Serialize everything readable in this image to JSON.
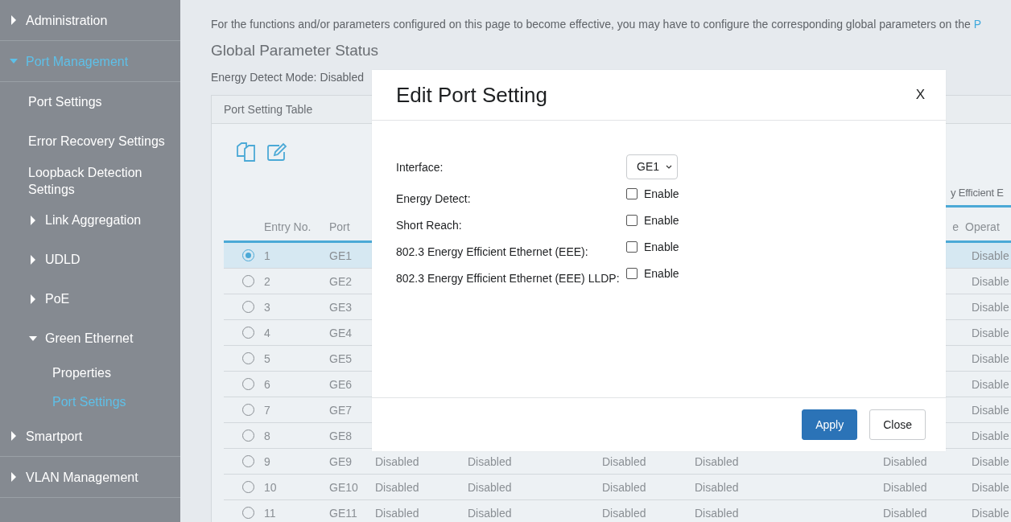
{
  "sidebar": {
    "items": [
      {
        "label": "Administration",
        "expanded": false,
        "selected": false
      },
      {
        "label": "Port Management",
        "expanded": true,
        "selected": true,
        "children": [
          {
            "label": "Port Settings",
            "selected": false
          },
          {
            "label": "Error Recovery Settings",
            "selected": false
          },
          {
            "label": "Loopback Detection Settings",
            "selected": false
          },
          {
            "label": "Link Aggregation",
            "expanded": false,
            "selected": false
          },
          {
            "label": "UDLD",
            "expanded": false,
            "selected": false
          },
          {
            "label": "PoE",
            "expanded": false,
            "selected": false
          },
          {
            "label": "Green Ethernet",
            "expanded": true,
            "selected": false,
            "children": [
              {
                "label": "Properties",
                "selected": false
              },
              {
                "label": "Port Settings",
                "selected": true
              }
            ]
          }
        ]
      },
      {
        "label": "Smartport",
        "expanded": false,
        "selected": false
      },
      {
        "label": "VLAN Management",
        "expanded": false,
        "selected": false
      }
    ]
  },
  "notice": {
    "text": "For the functions and/or parameters configured on this page to become effective, you may have to configure the corresponding global parameters on the",
    "link": "P"
  },
  "heading": "Global Parameter Status",
  "status": {
    "label": "Energy Detect Mode:",
    "value": "Disabled"
  },
  "table": {
    "title": "Port Setting Table",
    "group_header": "y Efficient E",
    "columns": [
      "Entry No.",
      "Port",
      "e",
      "Operat"
    ],
    "rows": [
      {
        "selected": true,
        "entry": "1",
        "port": "GE1",
        "operational": "Disable"
      },
      {
        "selected": false,
        "entry": "2",
        "port": "GE2",
        "operational": "Disable"
      },
      {
        "selected": false,
        "entry": "3",
        "port": "GE3",
        "operational": "Disable"
      },
      {
        "selected": false,
        "entry": "4",
        "port": "GE4",
        "operational": "Disable"
      },
      {
        "selected": false,
        "entry": "5",
        "port": "GE5",
        "operational": "Disable"
      },
      {
        "selected": false,
        "entry": "6",
        "port": "GE6",
        "operational": "Disable"
      },
      {
        "selected": false,
        "entry": "7",
        "port": "GE7",
        "operational": "Disable"
      },
      {
        "selected": false,
        "entry": "8",
        "port": "GE8",
        "operational": "Disable"
      },
      {
        "selected": false,
        "entry": "9",
        "port": "GE9",
        "values": [
          "Disabled",
          "Disabled",
          "Disabled",
          "Disabled",
          "Disabled"
        ],
        "operational": "Disable"
      },
      {
        "selected": false,
        "entry": "10",
        "port": "GE10",
        "values": [
          "Disabled",
          "Disabled",
          "Disabled",
          "Disabled",
          "Disabled"
        ],
        "operational": "Disable"
      },
      {
        "selected": false,
        "entry": "11",
        "port": "GE11",
        "values": [
          "Disabled",
          "Disabled",
          "Disabled",
          "Disabled",
          "Disabled"
        ],
        "operational": "Disable"
      }
    ]
  },
  "dialog": {
    "title": "Edit Port Setting",
    "close": "X",
    "interface": {
      "label": "Interface:",
      "value": "GE1"
    },
    "options": [
      {
        "label": "Energy Detect:",
        "text": "Enable",
        "checked": false
      },
      {
        "label": "Short Reach:",
        "text": "Enable",
        "checked": false
      },
      {
        "label": "802.3 Energy Efficient Ethernet (EEE):",
        "text": "Enable",
        "checked": false
      },
      {
        "label": "802.3 Energy Efficient Ethernet (EEE) LLDP:",
        "text": "Enable",
        "checked": false
      }
    ],
    "buttons": [
      {
        "label": "Apply",
        "kind": "primary"
      },
      {
        "label": "Close",
        "kind": "secondary"
      }
    ]
  }
}
